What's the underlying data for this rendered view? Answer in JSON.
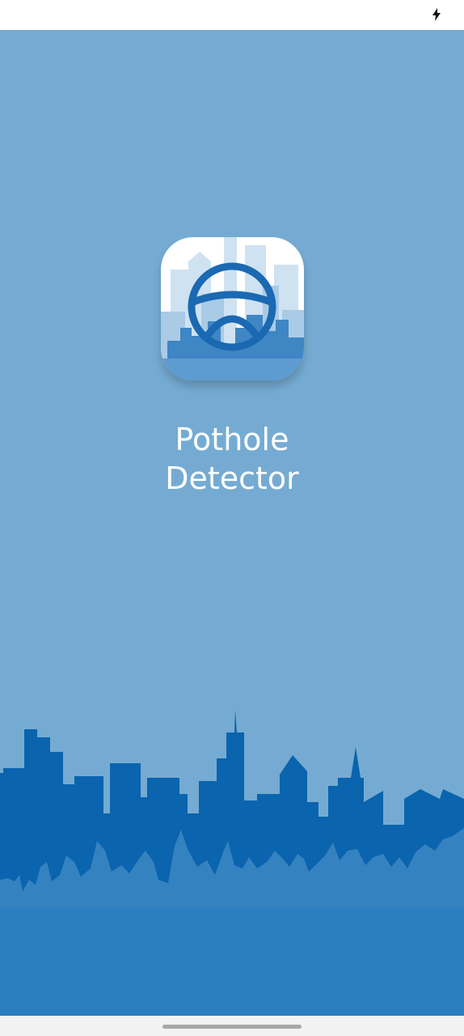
{
  "status_bar": {
    "icons": [
      "charging-bolt-icon"
    ]
  },
  "splash": {
    "background_color": "#75abd2",
    "icon": {
      "name": "steering-wheel-icon",
      "accent_color": "#1b69b2"
    },
    "title_line1": "Pothole",
    "title_line2": "Detector",
    "skyline_colors": {
      "dark": "#0a64ae",
      "mid": "#3482c0",
      "ground": "#2b7fbf"
    }
  },
  "nav_bar": {
    "home_indicator": "home-indicator"
  }
}
